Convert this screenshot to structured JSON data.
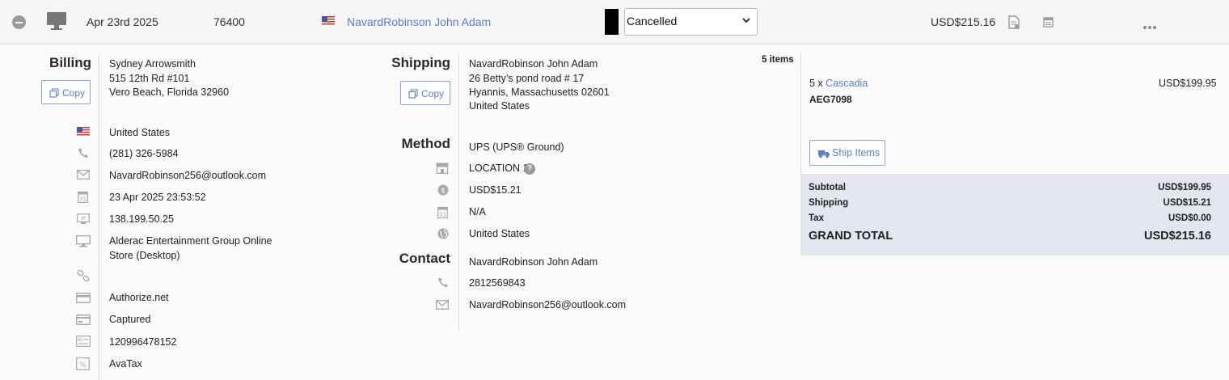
{
  "order": {
    "date": "Apr 23rd 2025",
    "number": "76400",
    "customer_name": "NavardRobinson John Adam",
    "status": "Cancelled",
    "total": "USD$215.16"
  },
  "billing": {
    "title": "Billing",
    "copy_label": "Copy",
    "name": "Sydney Arrowsmith",
    "address1": "515 12th Rd #101",
    "address2": "Vero Beach, Florida 32960",
    "country": "United States",
    "phone": "(281) 326-5984",
    "email": "NavardRobinson256@outlook.com",
    "date_time": "23 Apr 2025 23:53:52",
    "ip": "138.199.50.25",
    "store_line1": "Alderac Entertainment Group Online",
    "store_line2": "Store (Desktop)",
    "payment_gateway": "Authorize.net",
    "payment_status": "Captured",
    "transaction_id": "120996478152",
    "tax_provider": "AvaTax"
  },
  "shipping": {
    "title": "Shipping",
    "copy_label": "Copy",
    "name": "NavardRobinson John Adam",
    "address1": "26 Betty’s pond road # 17",
    "address2": "Hyannis, Massachusetts 02601",
    "country": "United States"
  },
  "method": {
    "title": "Method",
    "carrier": "UPS (UPS® Ground)",
    "location": "LOCATION 1",
    "cost": "USD$15.21",
    "date": "N/A",
    "country_link": "United States"
  },
  "contact": {
    "title": "Contact",
    "name": "NavardRobinson John Adam",
    "phone": "2812569843",
    "email": "NavardRobinson256@outlook.com"
  },
  "items": {
    "count_label": "5 items",
    "line_qty": "5 x",
    "line_name": "Cascadia",
    "line_sku": "AEG7098",
    "line_price": "USD$199.95",
    "ship_button": "Ship Items"
  },
  "totals": {
    "subtotal_label": "Subtotal",
    "subtotal": "USD$199.95",
    "shipping_label": "Shipping",
    "shipping": "USD$15.21",
    "tax_label": "Tax",
    "tax": "USD$0.00",
    "grand_label": "GRAND TOTAL",
    "grand": "USD$215.16"
  },
  "colors": {
    "link": "#5b7fc9",
    "totals_bg": "#e3e6ee",
    "header_bg": "#f5f5f7"
  },
  "icons": [
    "minus-circle-icon",
    "monitor-icon",
    "us-flag-icon",
    "chevron-down-icon",
    "invoice-icon",
    "calendar-icon",
    "more-dots-icon",
    "copy-icon",
    "phone-icon",
    "envelope-icon",
    "ip-icon",
    "link-icon",
    "credit-card-icon",
    "card-status-icon",
    "id-card-icon",
    "percent-icon",
    "store-icon",
    "dollar-circle-icon",
    "globe-icon",
    "truck-icon",
    "help-icon"
  ]
}
